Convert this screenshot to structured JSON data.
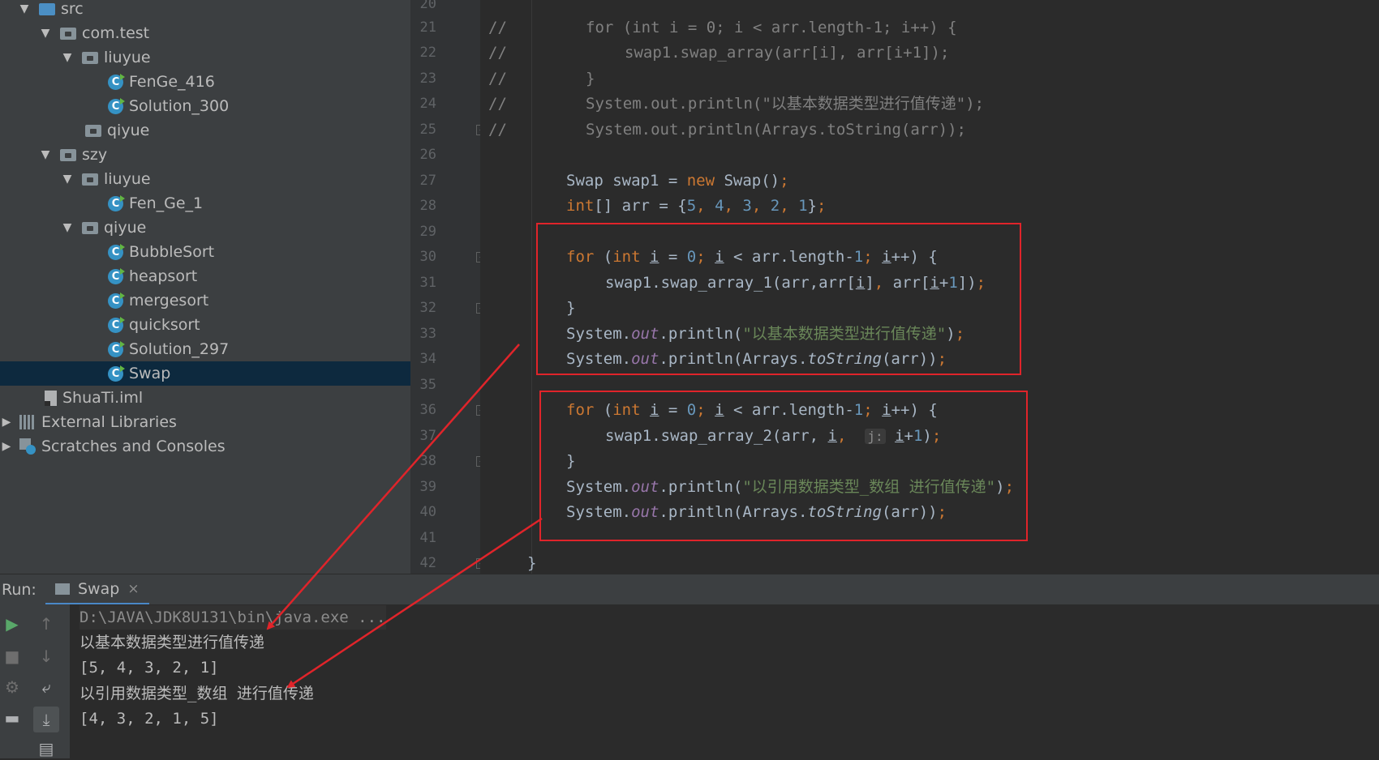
{
  "project_tree": [
    {
      "label": "src",
      "icon": "source-folder-icon",
      "arrow": "▼"
    },
    {
      "label": "com.test",
      "icon": "package-folder-icon",
      "arrow": "▼"
    },
    {
      "label": "liuyue",
      "icon": "package-folder-icon",
      "arrow": "▼"
    },
    {
      "label": "FenGe_416",
      "icon": "java-class-icon"
    },
    {
      "label": "Solution_300",
      "icon": "java-class-icon"
    },
    {
      "label": "qiyue",
      "icon": "package-folder-icon"
    },
    {
      "label": "szy",
      "icon": "package-folder-icon",
      "arrow": "▼"
    },
    {
      "label": "liuyue",
      "icon": "package-folder-icon",
      "arrow": "▼"
    },
    {
      "label": "Fen_Ge_1",
      "icon": "java-class-icon"
    },
    {
      "label": "qiyue",
      "icon": "package-folder-icon",
      "arrow": "▼"
    },
    {
      "label": "BubbleSort",
      "icon": "java-class-icon"
    },
    {
      "label": "heapsort",
      "icon": "java-class-icon"
    },
    {
      "label": "mergesort",
      "icon": "java-class-icon"
    },
    {
      "label": "quicksort",
      "icon": "java-class-icon"
    },
    {
      "label": "Solution_297",
      "icon": "java-class-icon"
    },
    {
      "label": "Swap",
      "icon": "java-class-icon",
      "selected": true
    },
    {
      "label": "ShuaTi.iml",
      "icon": "iml-file-icon"
    },
    {
      "label": "External Libraries",
      "icon": "libraries-icon",
      "arrow": "▶"
    },
    {
      "label": "Scratches and Consoles",
      "icon": "scratches-icon",
      "arrow": "▶"
    }
  ],
  "line_numbers": [
    "20",
    "21",
    "22",
    "23",
    "24",
    "25",
    "26",
    "27",
    "28",
    "29",
    "30",
    "31",
    "32",
    "33",
    "34",
    "35",
    "36",
    "37",
    "38",
    "39",
    "40",
    "41",
    "42"
  ],
  "code": {
    "l21_comment": "//",
    "l21": "for (int i = 0; i < arr.length-1; i++) {",
    "l22_comment": "//",
    "l22": "swap1.swap_array(arr[i], arr[i+1]);",
    "l23_comment": "//",
    "l23": "}",
    "l24_comment": "//",
    "l24": "System.out.println(\"以基本数据类型进行值传递\");",
    "l25_comment": "//",
    "l25": "System.out.println(Arrays.toString(arr));",
    "l27_type": "Swap",
    "l27_var": " swap1 = ",
    "l27_new": "new",
    "l27_rest": " Swap()",
    "l28_type": "int",
    "l28_rest": "[] arr = {",
    "l28_values": [
      "5",
      "4",
      "3",
      "2",
      "1"
    ],
    "for_kw": "for",
    "int_kw": "int",
    "loop_var": "i",
    "zero": "0",
    "one": "1",
    "arr_length": " arr.length-",
    "l31_call": "swap1.swap_array_1(arr,arr[",
    "l37_call": "swap1.swap_array_2(arr, ",
    "l37_hint": "j:",
    "system": "System.",
    "out": "out",
    "println": ".println(",
    "str1": "\"以基本数据类型进行值传递\"",
    "str2": "\"以引用数据类型_数组 进行值传递\"",
    "arrays": "Arrays.",
    "tostring": "toString",
    "arr_arg": "(arr))",
    "close_brace": "}"
  },
  "run": {
    "label": "Run:",
    "tab": "Swap",
    "close": "×",
    "console": [
      "D:\\JAVA\\JDK8U131\\bin\\java.exe ...",
      "以基本数据类型进行值传递",
      "[5, 4, 3, 2, 1]",
      "以引用数据类型_数组 进行值传递",
      "[4, 3, 2, 1, 5]"
    ]
  },
  "colors": {
    "annotation": "#e0242a",
    "selection": "#0d293e",
    "keyword": "#cc7832",
    "number": "#6897bb",
    "string": "#6a8759",
    "field": "#9876aa"
  }
}
